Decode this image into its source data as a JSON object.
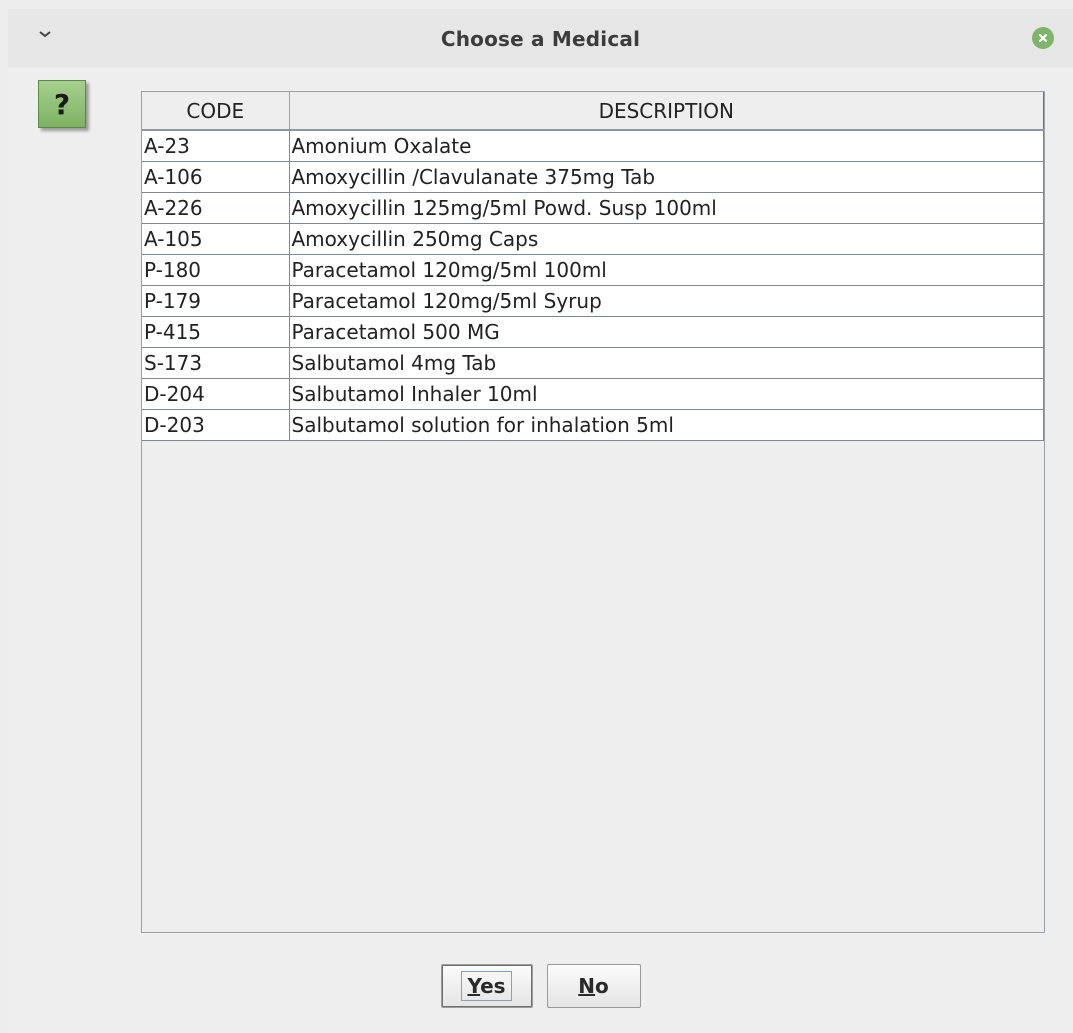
{
  "window": {
    "title": "Choose a Medical"
  },
  "help": {
    "glyph": "?"
  },
  "table": {
    "headers": [
      "CODE",
      "DESCRIPTION"
    ],
    "rows": [
      [
        "A-23",
        "Amonium Oxalate"
      ],
      [
        "A-106",
        "Amoxycillin /Clavulanate 375mg Tab"
      ],
      [
        "A-226",
        "Amoxycillin 125mg/5ml Powd. Susp 100ml"
      ],
      [
        "A-105",
        "Amoxycillin 250mg Caps"
      ],
      [
        "P-180",
        "Paracetamol 120mg/5ml 100ml"
      ],
      [
        "P-179",
        "Paracetamol 120mg/5ml Syrup"
      ],
      [
        "P-415",
        "Paracetamol 500 MG"
      ],
      [
        "S-173",
        "Salbutamol 4mg Tab"
      ],
      [
        "D-204",
        "Salbutamol Inhaler 10ml"
      ],
      [
        "D-203",
        "Salbutamol solution for inhalation 5ml"
      ]
    ]
  },
  "buttons": {
    "yes": {
      "mnemonic": "Y",
      "rest": "es"
    },
    "no": {
      "mnemonic": "N",
      "rest": "o"
    }
  },
  "colors": {
    "accent_green": "#7eb56b",
    "grid_line": "#7f8694"
  }
}
